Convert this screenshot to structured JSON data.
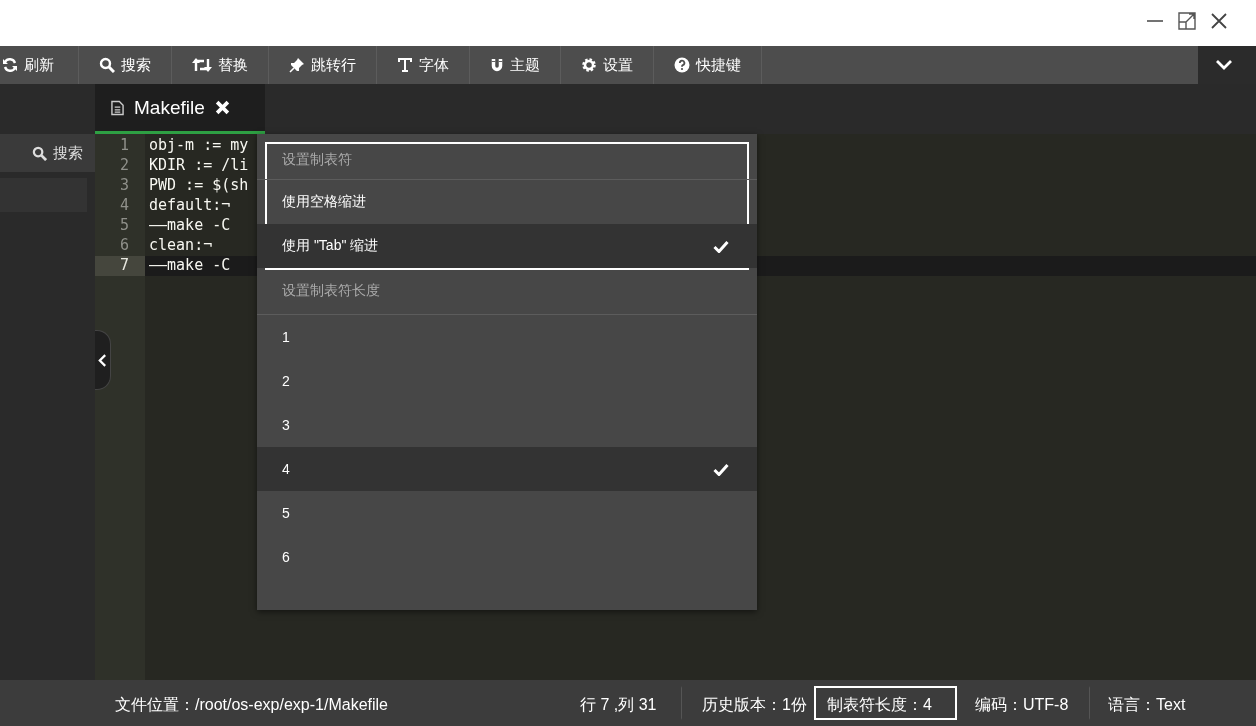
{
  "window_controls": [
    {
      "kind": "minimize"
    },
    {
      "kind": "maximize"
    },
    {
      "kind": "close"
    }
  ],
  "toolbar": [
    {
      "kind": "refresh",
      "label": "刷新"
    },
    {
      "kind": "search",
      "label": "搜索"
    },
    {
      "kind": "replace",
      "label": "替换"
    },
    {
      "kind": "pin",
      "label": "跳转行"
    },
    {
      "kind": "font",
      "label": "字体"
    },
    {
      "kind": "magnet",
      "label": "主题"
    },
    {
      "kind": "gear",
      "label": "设置"
    },
    {
      "kind": "help",
      "label": "快捷键"
    }
  ],
  "sidebar": {
    "actions": [
      {
        "kind": "search",
        "label": "搜索"
      }
    ]
  },
  "tabs": [
    {
      "label": "Makefile",
      "selected": true
    }
  ],
  "editor": {
    "lines": [
      {
        "number": "1",
        "text": "obj-m := my",
        "current": false
      },
      {
        "number": "2",
        "text": "KDIR := /li",
        "current": false
      },
      {
        "number": "3",
        "text": "PWD := $(sh",
        "current": false
      },
      {
        "number": "4",
        "text": "default:¬",
        "current": false
      },
      {
        "number": "5",
        "text": "——make -C",
        "current": false
      },
      {
        "number": "6",
        "text": "clean:¬",
        "current": false
      },
      {
        "number": "7",
        "text": "——make -C",
        "current": true
      }
    ]
  },
  "menu": {
    "groups": [
      {
        "title": "设置制表符",
        "outlined": true,
        "items": [
          {
            "label": "使用空格缩进",
            "selected": false
          },
          {
            "label": "使用 \"Tab\" 缩进",
            "selected": true
          }
        ]
      },
      {
        "title": "设置制表符长度",
        "outlined": false,
        "items": [
          {
            "label": "1",
            "selected": false
          },
          {
            "label": "2",
            "selected": false
          },
          {
            "label": "3",
            "selected": false
          },
          {
            "label": "4",
            "selected": true
          },
          {
            "label": "5",
            "selected": false
          },
          {
            "label": "6",
            "selected": false
          }
        ]
      }
    ]
  },
  "status_bar": [
    {
      "text": "文件位置：/root/os-exp/exp-1/Makefile",
      "outlined": false
    },
    {
      "text": "行 7 ,列 31",
      "outlined": false
    },
    {
      "text": "历史版本：1份",
      "outlined": false
    },
    {
      "text": "制表符长度：4",
      "outlined": true
    },
    {
      "text": "编码：UTF-8",
      "outlined": false
    },
    {
      "text": "语言：Text",
      "outlined": false
    }
  ]
}
